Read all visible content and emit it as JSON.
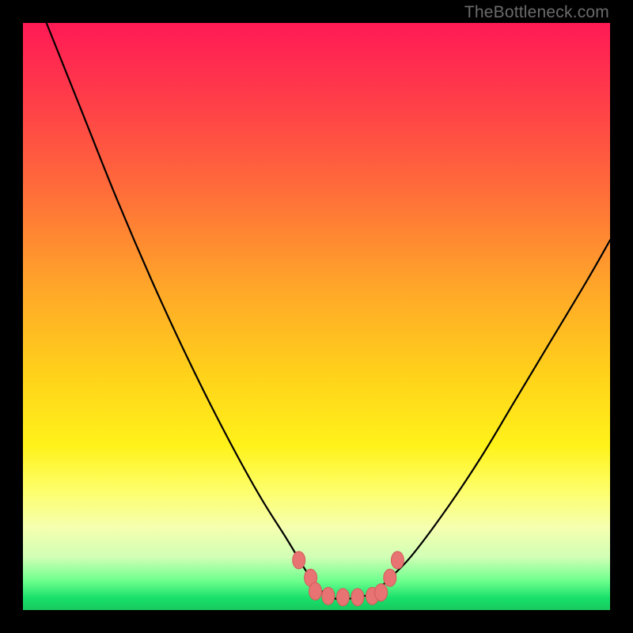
{
  "watermark": "TheBottleneck.com",
  "colors": {
    "frame": "#000000",
    "curve": "#000000",
    "marker_fill": "#e87373",
    "marker_stroke": "#d45b5b",
    "gradient_stops": [
      "#ff1a55",
      "#ff3a4a",
      "#ff6b3a",
      "#ffa629",
      "#ffd21a",
      "#fff21a",
      "#fdff6e",
      "#f5ffb0",
      "#d0ffb5",
      "#6eff8e",
      "#18e06a",
      "#18c95e"
    ]
  },
  "chart_data": {
    "type": "line",
    "title": "",
    "xlabel": "",
    "ylabel": "",
    "xlim": [
      0,
      100
    ],
    "ylim": [
      0,
      100
    ],
    "grid": false,
    "legend": false,
    "annotations": [
      "TheBottleneck.com"
    ],
    "series": [
      {
        "name": "bottleneck-curve",
        "comment": "V-shaped curve; x is normalized 0–100 left→right, y is normalized 0–100 where 0=top (red / worst) and 100=bottom (green / best). Values estimated from pixel positions.",
        "x": [
          4,
          10,
          16,
          22,
          28,
          34,
          40,
          45,
          48,
          50,
          53,
          56,
          60,
          62,
          66,
          72,
          78,
          84,
          90,
          96,
          100
        ],
        "y": [
          0,
          15,
          30,
          44,
          57,
          69,
          80,
          88,
          93,
          96,
          98,
          98,
          97,
          95,
          91,
          83,
          74,
          64,
          54,
          44,
          37
        ]
      },
      {
        "name": "highlight-markers",
        "comment": "Salmon dot cluster around the valley floor; same coordinate convention.",
        "x": [
          47.0,
          49.0,
          49.8,
          52.0,
          54.5,
          57.0,
          59.5,
          61.0,
          62.5,
          63.8
        ],
        "y": [
          91.5,
          94.5,
          96.8,
          97.6,
          97.8,
          97.8,
          97.6,
          97.0,
          94.5,
          91.5
        ]
      }
    ]
  }
}
